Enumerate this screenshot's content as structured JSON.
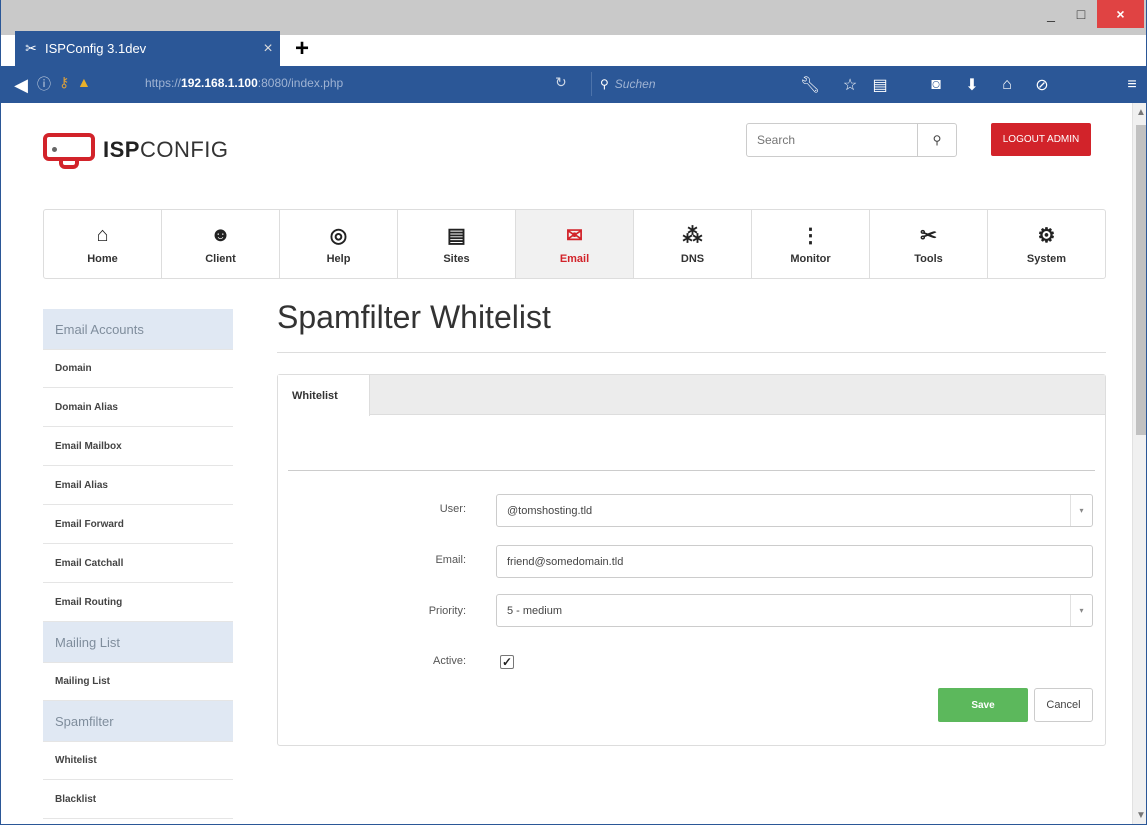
{
  "browser": {
    "tab_title": "ISPConfig 3.1dev",
    "tab_close": "×",
    "new_tab": "+",
    "url_prefix": "https://",
    "url_host": "192.168.1.100",
    "url_suffix": ":8080/index.php",
    "search_placeholder": "Suchen",
    "window_minimize": "_",
    "window_maximize": "□",
    "window_close": "×"
  },
  "header": {
    "logo_bold": "ISP",
    "logo_light": "CONFIG",
    "search_placeholder": "Search",
    "logout_label": "LOGOUT ADMIN"
  },
  "mainnav": {
    "items": [
      {
        "label": "Home",
        "icon": "home-icon"
      },
      {
        "label": "Client",
        "icon": "users-icon"
      },
      {
        "label": "Help",
        "icon": "lifebuoy-icon"
      },
      {
        "label": "Sites",
        "icon": "document-icon"
      },
      {
        "label": "Email",
        "icon": "envelope-icon"
      },
      {
        "label": "DNS",
        "icon": "network-icon"
      },
      {
        "label": "Monitor",
        "icon": "traffic-light-icon"
      },
      {
        "label": "Tools",
        "icon": "tools-icon"
      },
      {
        "label": "System",
        "icon": "gear-icon"
      }
    ],
    "active": "Email"
  },
  "sidebar": {
    "sections": [
      {
        "header": "Email Accounts",
        "links": [
          "Domain",
          "Domain Alias",
          "Email Mailbox",
          "Email Alias",
          "Email Forward",
          "Email Catchall",
          "Email Routing"
        ]
      },
      {
        "header": "Mailing List",
        "links": [
          "Mailing List"
        ]
      },
      {
        "header": "Spamfilter",
        "links": [
          "Whitelist",
          "Blacklist"
        ]
      }
    ]
  },
  "main": {
    "title": "Spamfilter Whitelist",
    "tab": "Whitelist",
    "fields": {
      "user_label": "User:",
      "user_value": "@tomshosting.tld",
      "email_label": "Email:",
      "email_value": "friend@somedomain.tld",
      "priority_label": "Priority:",
      "priority_value": "5 - medium",
      "active_label": "Active:",
      "active_checked": true
    },
    "save_label": "Save",
    "cancel_label": "Cancel"
  },
  "colors": {
    "chrome_blue": "#2b5797",
    "brand_red": "#d2232a",
    "save_green": "#5cb85c",
    "sidebar_header_bg": "#e0e8f3"
  }
}
